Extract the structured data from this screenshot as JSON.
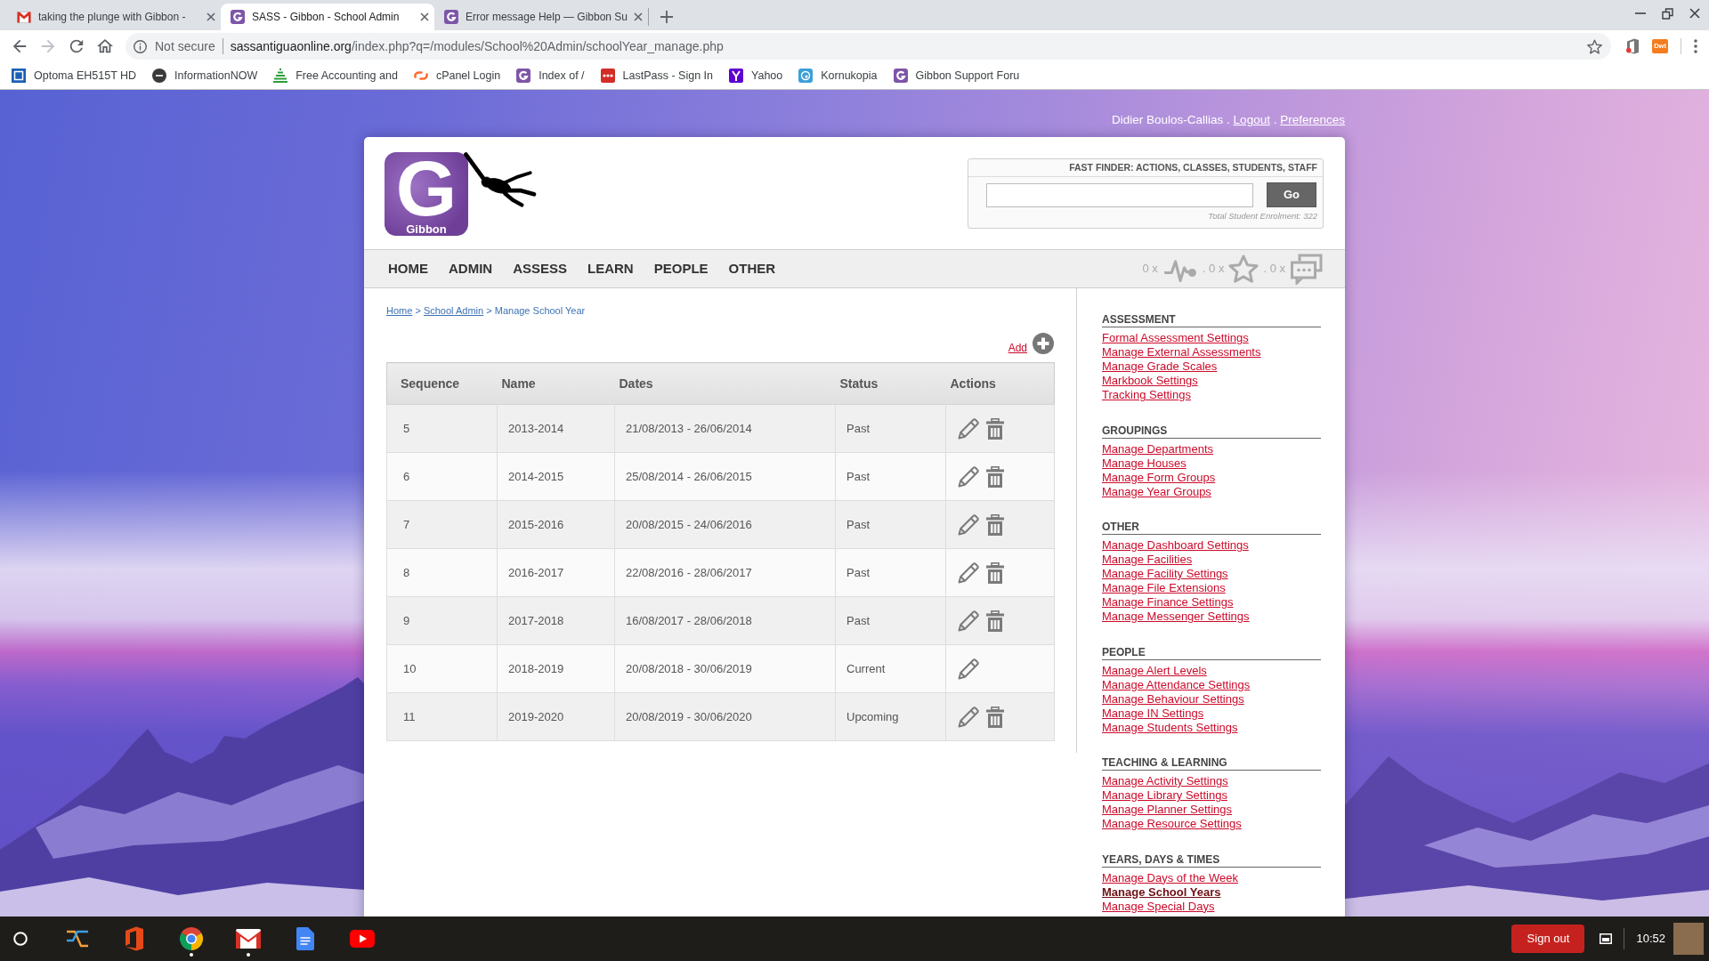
{
  "browser": {
    "tabs": [
      {
        "title": "taking the plunge with Gibbon -",
        "kind": "mail",
        "selected": false
      },
      {
        "title": "SASS - Gibbon - School Admin",
        "kind": "gibbon",
        "selected": true
      },
      {
        "title": "Error message Help — Gibbon Su",
        "kind": "gibbon",
        "selected": false
      }
    ],
    "nav_buttons": [
      {
        "kind": "back",
        "disabled": false
      },
      {
        "kind": "forward",
        "disabled": true
      },
      {
        "kind": "reload",
        "disabled": false
      },
      {
        "kind": "home",
        "disabled": false
      }
    ],
    "address_bar": {
      "security": "Not secure",
      "host": "sassantiguaonline.org",
      "path": "/index.php?q=/modules/School%20Admin/schoolYear_manage.php"
    },
    "extensions": [
      {
        "kind": "door"
      },
      {
        "kind": "badge",
        "label": "Dwt"
      }
    ],
    "bookmarks": [
      {
        "label": "Optoma EH515T HD",
        "kind": "square"
      },
      {
        "label": "InformationNOW",
        "kind": "disc"
      },
      {
        "label": "Free Accounting and",
        "kind": "stack"
      },
      {
        "label": "cPanel Login",
        "kind": "swoosh"
      },
      {
        "label": "Index of /",
        "kind": "gibbon"
      },
      {
        "label": "LastPass - Sign In",
        "kind": "dots"
      },
      {
        "label": "Yahoo",
        "kind": "fork"
      },
      {
        "label": "Kornukopia",
        "kind": "swirl"
      },
      {
        "label": "Gibbon Support Foru",
        "kind": "gibbon"
      }
    ]
  },
  "page": {
    "user_bar": [
      {
        "kind": "text",
        "label": "Didier Boulos-Callias"
      },
      {
        "kind": "separator",
        "label": "."
      },
      {
        "kind": "link",
        "label": "Logout"
      },
      {
        "kind": "separator",
        "label": "."
      },
      {
        "kind": "link",
        "label": "Preferences"
      }
    ],
    "logo": {
      "letter": "G",
      "caption": "Gibbon"
    },
    "fast_finder": {
      "title": "FAST FINDER: ACTIONS, CLASSES, STUDENTS, STAFF",
      "button": "Go",
      "note": "Total Student Enrolment: 322"
    },
    "main_menu": [
      "HOME",
      "ADMIN",
      "ASSESS",
      "LEARN",
      "PEOPLE",
      "OTHER"
    ],
    "notifications": [
      {
        "kind": "pulse",
        "count": "0 x"
      },
      {
        "kind": "star",
        "count": ". 0 x"
      },
      {
        "kind": "chat",
        "count": ". 0 x"
      }
    ],
    "breadcrumb": [
      {
        "kind": "link",
        "label": "Home"
      },
      {
        "kind": "separator",
        "label": ">"
      },
      {
        "kind": "link",
        "label": "School Admin"
      },
      {
        "kind": "separator",
        "label": ">"
      },
      {
        "kind": "text",
        "label": "Manage School Year"
      }
    ],
    "add_link": "Add",
    "table": {
      "columns": [
        "Sequence",
        "Name",
        "Dates",
        "Status",
        "Actions"
      ],
      "rows": [
        {
          "sequence": "5",
          "name": "2013-2014",
          "dates": "21/08/2013 - 26/06/2014",
          "status": "Past",
          "actions": [
            {
              "kind": "edit"
            },
            {
              "kind": "delete"
            }
          ]
        },
        {
          "sequence": "6",
          "name": "2014-2015",
          "dates": "25/08/2014 - 26/06/2015",
          "status": "Past",
          "actions": [
            {
              "kind": "edit"
            },
            {
              "kind": "delete"
            }
          ]
        },
        {
          "sequence": "7",
          "name": "2015-2016",
          "dates": "20/08/2015 - 24/06/2016",
          "status": "Past",
          "actions": [
            {
              "kind": "edit"
            },
            {
              "kind": "delete"
            }
          ]
        },
        {
          "sequence": "8",
          "name": "2016-2017",
          "dates": "22/08/2016 - 28/06/2017",
          "status": "Past",
          "actions": [
            {
              "kind": "edit"
            },
            {
              "kind": "delete"
            }
          ]
        },
        {
          "sequence": "9",
          "name": "2017-2018",
          "dates": "16/08/2017 - 28/06/2018",
          "status": "Past",
          "actions": [
            {
              "kind": "edit"
            },
            {
              "kind": "delete"
            }
          ]
        },
        {
          "sequence": "10",
          "name": "2018-2019",
          "dates": "20/08/2018 - 30/06/2019",
          "status": "Current",
          "actions": [
            {
              "kind": "edit"
            }
          ]
        },
        {
          "sequence": "11",
          "name": "2019-2020",
          "dates": "20/08/2019 - 30/06/2020",
          "status": "Upcoming",
          "actions": [
            {
              "kind": "edit"
            },
            {
              "kind": "delete"
            }
          ]
        }
      ]
    },
    "sidebar": [
      {
        "heading": "ASSESSMENT",
        "links": [
          {
            "label": "Formal Assessment Settings",
            "selected": false
          },
          {
            "label": "Manage External Assessments",
            "selected": false
          },
          {
            "label": "Manage Grade Scales",
            "selected": false
          },
          {
            "label": "Markbook Settings",
            "selected": false
          },
          {
            "label": "Tracking Settings",
            "selected": false
          }
        ]
      },
      {
        "heading": "GROUPINGS",
        "links": [
          {
            "label": "Manage Departments",
            "selected": false
          },
          {
            "label": "Manage Houses",
            "selected": false
          },
          {
            "label": "Manage Form Groups",
            "selected": false
          },
          {
            "label": "Manage Year Groups",
            "selected": false
          }
        ]
      },
      {
        "heading": "OTHER",
        "links": [
          {
            "label": "Manage Dashboard Settings",
            "selected": false
          },
          {
            "label": "Manage Facilities",
            "selected": false
          },
          {
            "label": "Manage Facility Settings",
            "selected": false
          },
          {
            "label": "Manage File Extensions",
            "selected": false
          },
          {
            "label": "Manage Finance Settings",
            "selected": false
          },
          {
            "label": "Manage Messenger Settings",
            "selected": false
          }
        ]
      },
      {
        "heading": "PEOPLE",
        "links": [
          {
            "label": "Manage Alert Levels",
            "selected": false
          },
          {
            "label": "Manage Attendance Settings",
            "selected": false
          },
          {
            "label": "Manage Behaviour Settings",
            "selected": false
          },
          {
            "label": "Manage IN Settings",
            "selected": false
          },
          {
            "label": "Manage Students Settings",
            "selected": false
          }
        ]
      },
      {
        "heading": "TEACHING & LEARNING",
        "links": [
          {
            "label": "Manage Activity Settings",
            "selected": false
          },
          {
            "label": "Manage Library Settings",
            "selected": false
          },
          {
            "label": "Manage Planner Settings",
            "selected": false
          },
          {
            "label": "Manage Resource Settings",
            "selected": false
          }
        ]
      },
      {
        "heading": "YEARS, DAYS & TIMES",
        "links": [
          {
            "label": "Manage Days of the Week",
            "selected": false
          },
          {
            "label": "Manage School Years",
            "selected": true
          },
          {
            "label": "Manage Special Days",
            "selected": false
          }
        ]
      }
    ]
  },
  "taskbar": {
    "apps": [
      {
        "kind": "lines",
        "running": false
      },
      {
        "kind": "door",
        "running": false
      },
      {
        "kind": "chrome",
        "running": true
      },
      {
        "kind": "mail",
        "running": true
      },
      {
        "kind": "document",
        "running": false
      },
      {
        "kind": "video",
        "running": false
      }
    ],
    "sign_out": "Sign out",
    "time": "10:52"
  }
}
